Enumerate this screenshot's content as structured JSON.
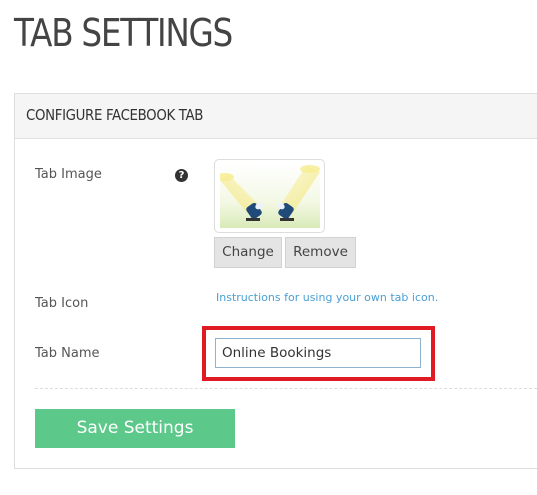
{
  "page": {
    "title": "TAB SETTINGS"
  },
  "panel": {
    "title": "CONFIGURE FACEBOOK TAB"
  },
  "form": {
    "tab_image_label": "Tab Image",
    "help_icon_glyph": "?",
    "change_label": "Change",
    "remove_label": "Remove",
    "tab_icon_label": "Tab Icon",
    "tab_icon_link": "Instructions for using your own tab icon.",
    "tab_name_label": "Tab Name",
    "tab_name_value": "Online Bookings",
    "save_label": "Save Settings"
  },
  "icons": {
    "help": "question-circle-icon",
    "tab_image": "spotlights-image"
  },
  "colors": {
    "save_button": "#5cc98a",
    "link": "#4aa0d5",
    "highlight": "#e01b24"
  }
}
